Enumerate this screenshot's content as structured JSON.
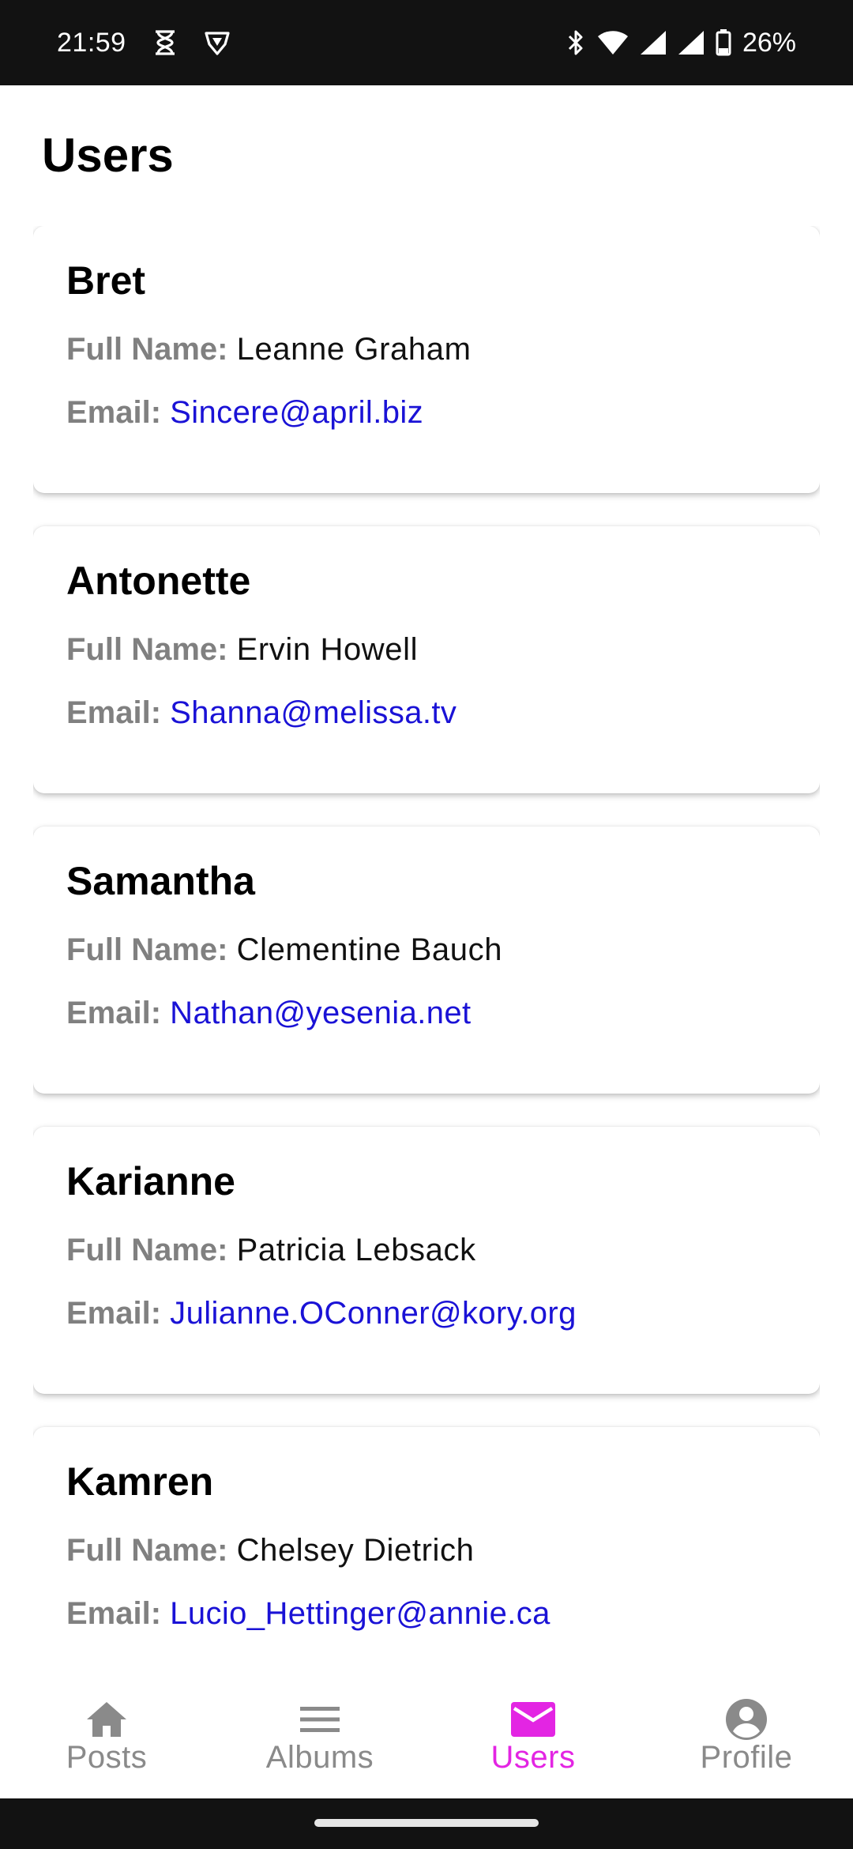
{
  "status_bar": {
    "time": "21:59",
    "battery": "26%",
    "icons": [
      "hourglass-icon",
      "shield-icon",
      "bluetooth-icon",
      "wifi-icon",
      "signal-icon",
      "signal-icon",
      "battery-icon"
    ]
  },
  "header": {
    "title": "Users"
  },
  "labels": {
    "full_name": "Full Name:",
    "email": "Email:"
  },
  "users": [
    {
      "username": "Bret",
      "full_name": "Leanne Graham",
      "email": "Sincere@april.biz"
    },
    {
      "username": "Antonette",
      "full_name": "Ervin Howell",
      "email": "Shanna@melissa.tv"
    },
    {
      "username": "Samantha",
      "full_name": "Clementine Bauch",
      "email": "Nathan@yesenia.net"
    },
    {
      "username": "Karianne",
      "full_name": "Patricia Lebsack",
      "email": "Julianne.OConner@kory.org"
    },
    {
      "username": "Kamren",
      "full_name": "Chelsey Dietrich",
      "email": "Lucio_Hettinger@annie.ca"
    }
  ],
  "bottom_nav": {
    "items": [
      {
        "label": "Posts",
        "icon": "home-icon",
        "active": false
      },
      {
        "label": "Albums",
        "icon": "menu-icon",
        "active": false
      },
      {
        "label": "Users",
        "icon": "mail-icon",
        "active": true
      },
      {
        "label": "Profile",
        "icon": "account-icon",
        "active": false
      }
    ]
  },
  "colors": {
    "accent": "#e325e3",
    "link": "#1a12d6",
    "label": "#808080",
    "status_bar": "#121212"
  }
}
